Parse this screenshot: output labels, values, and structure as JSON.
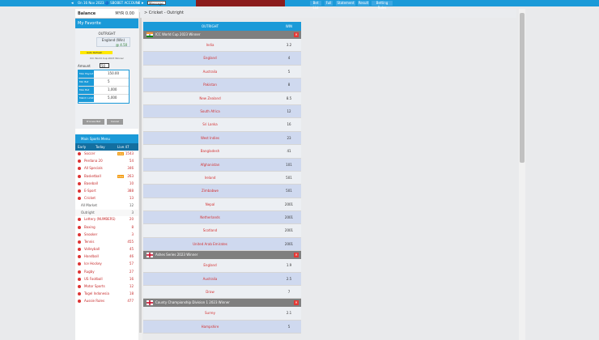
{
  "topbar": {
    "ticker": "On 16 Nov 2023 🔵 SBOBET ACCOUNT •",
    "message_label": "Message",
    "right_buttons": [
      "Bet List",
      "Full",
      "Statement",
      "Result",
      "Betting Rules"
    ]
  },
  "sidebar": {
    "balance_label": "Balance",
    "balance_value": "MYR 0.00",
    "favorite_label": "My Favorite",
    "slip": {
      "title": "OUTRIGHT",
      "selection": "England (Win)",
      "selection_odds": "@ 4.50",
      "auto_refresh": "Auto Refresh",
      "market": "ICC World Cup 2023 Winner",
      "amount_label": "Amount",
      "amount_value": "50",
      "info": [
        {
          "label": "Max Payout",
          "value": "150.00"
        },
        {
          "label": "Min Bet",
          "value": "5"
        },
        {
          "label": "Max Bet",
          "value": "1,000"
        },
        {
          "label": "Match Limit",
          "value": "5,000"
        }
      ],
      "process_button": "Process Bet",
      "cancel_button": "Cancel"
    },
    "sports_menu": {
      "header": "Main Sports Menu",
      "tabs": [
        "Early",
        "Today",
        "Live 47"
      ],
      "items": [
        {
          "name": "Soccer",
          "count": "1543",
          "live": "Live"
        },
        {
          "name": "Perdana 20",
          "count": "54"
        },
        {
          "name": "All Specials",
          "count": "346"
        },
        {
          "name": "Basketball",
          "count": "263",
          "live": "Live"
        },
        {
          "name": "Baseball",
          "count": "10"
        },
        {
          "name": "E-Sport",
          "count": "388"
        },
        {
          "name": "Cricket",
          "count": "13"
        }
      ],
      "cricket_sub": [
        {
          "name": "All Market",
          "count": "12"
        },
        {
          "name": "Outright",
          "count": "3"
        }
      ],
      "items_after": [
        {
          "name": "Lottery (NUMBERS)",
          "count": "20"
        },
        {
          "name": "Boxing",
          "count": "8"
        },
        {
          "name": "Snooker",
          "count": "3"
        },
        {
          "name": "Tennis",
          "count": "455"
        },
        {
          "name": "Volleyball",
          "count": "45"
        },
        {
          "name": "Handball",
          "count": "46"
        },
        {
          "name": "Ice Hockey",
          "count": "57"
        },
        {
          "name": "Rugby",
          "count": "27"
        },
        {
          "name": "US Football",
          "count": "16"
        },
        {
          "name": "Motor Sports",
          "count": "12"
        },
        {
          "name": "Togel Indonesia",
          "count": "18"
        },
        {
          "name": "Aussie Rules",
          "count": "477"
        }
      ]
    }
  },
  "breadcrumb": "> Cricket - Outright",
  "table": {
    "col_outright": "OUTRIGHT",
    "col_win": "WIN",
    "groups": [
      {
        "name": "ICC World Cup 2023 Winner",
        "flag": "india",
        "rows": [
          {
            "team": "India",
            "odds": "3.2"
          },
          {
            "team": "England",
            "odds": "4"
          },
          {
            "team": "Australia",
            "odds": "5"
          },
          {
            "team": "Pakistan",
            "odds": "8"
          },
          {
            "team": "New Zealand",
            "odds": "8.5"
          },
          {
            "team": "South Africa",
            "odds": "12"
          },
          {
            "team": "Sri Lanka",
            "odds": "16"
          },
          {
            "team": "West Indies",
            "odds": "23"
          },
          {
            "team": "Bangladesh",
            "odds": "41"
          },
          {
            "team": "Afghanistan",
            "odds": "101"
          },
          {
            "team": "Ireland",
            "odds": "501"
          },
          {
            "team": "Zimbabwe",
            "odds": "501"
          },
          {
            "team": "Nepal",
            "odds": "2001"
          },
          {
            "team": "Netherlands",
            "odds": "2001"
          },
          {
            "team": "Scotland",
            "odds": "2001"
          },
          {
            "team": "United Arab Emirates",
            "odds": "2001"
          }
        ]
      },
      {
        "name": "Ashes Series 2023 Winner",
        "flag": "england",
        "rows": [
          {
            "team": "England",
            "odds": "1.9"
          },
          {
            "team": "Australia",
            "odds": "2.5"
          },
          {
            "team": "Draw",
            "odds": "7"
          }
        ]
      },
      {
        "name": "County Championship Division 1 2023 Winner",
        "flag": "england",
        "rows": [
          {
            "team": "Surrey",
            "odds": "2.1"
          },
          {
            "team": "Hampshire",
            "odds": "5"
          }
        ]
      }
    ]
  },
  "colors": {
    "accent": "#1b9ad8",
    "team_red": "#d32f2f",
    "group_grey": "#7f7f7f"
  }
}
